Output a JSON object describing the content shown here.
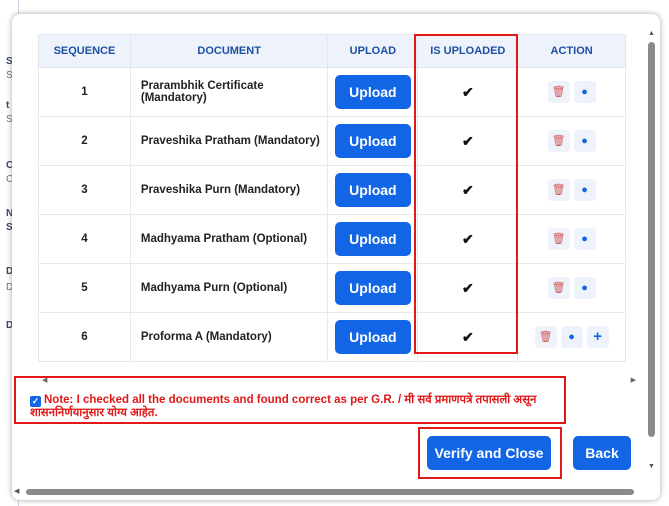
{
  "background": {
    "fragments": [
      "SI",
      "Se",
      "t",
      "Se",
      "CA",
      "Ca",
      "Na",
      "Si",
      "Do",
      "Do",
      "D"
    ]
  },
  "table": {
    "headers": {
      "sequence": "SEQUENCE",
      "document": "DOCUMENT",
      "upload": "UPLOAD",
      "is_uploaded": "IS UPLOADED",
      "action": "ACTION"
    },
    "upload_label": "Upload",
    "uploaded_mark": "✔",
    "rows": [
      {
        "seq": "1",
        "document": "Prarambhik Certificate (Mandatory)"
      },
      {
        "seq": "2",
        "document": "Praveshika Pratham (Mandatory)"
      },
      {
        "seq": "3",
        "document": "Praveshika Purn (Mandatory)"
      },
      {
        "seq": "4",
        "document": "Madhyama Pratham (Optional)"
      },
      {
        "seq": "5",
        "document": "Madhyama Purn (Optional)"
      },
      {
        "seq": "6",
        "document": "Proforma A (Mandatory)"
      }
    ]
  },
  "note": {
    "checked": true,
    "text": "Note: I checked all the documents and found correct as per G.R. / मी सर्व प्रमाणपत्रे तपासली असून शासननिर्णयानुसार योग्य आहेत."
  },
  "buttons": {
    "verify_close": "Verify and Close",
    "back": "Back"
  },
  "colors": {
    "primary": "#1266e6",
    "header_text": "#1d4fa3",
    "highlight": "#e01818"
  }
}
